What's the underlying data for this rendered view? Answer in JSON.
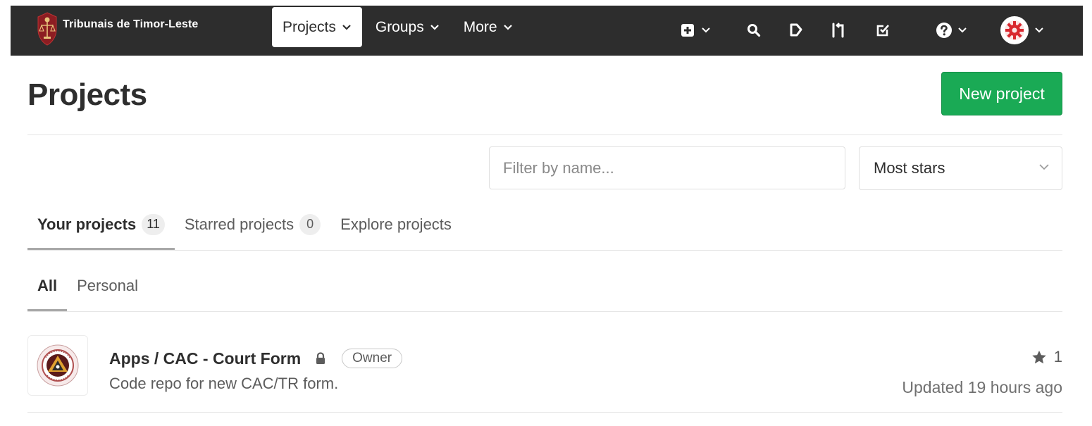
{
  "navbar": {
    "brand_name": "Tribunais de Timor-Leste",
    "menu": [
      {
        "label": "Projects",
        "active": true
      },
      {
        "label": "Groups",
        "active": false
      },
      {
        "label": "More",
        "active": false
      }
    ],
    "icons": [
      "plus-square-icon",
      "search-icon",
      "issues-icon",
      "merge-request-icon",
      "todo-icon",
      "help-icon",
      "user-avatar"
    ]
  },
  "header": {
    "title": "Projects",
    "new_project_label": "New project"
  },
  "filters": {
    "search_placeholder": "Filter by name...",
    "sort_selected": "Most stars"
  },
  "tabs": [
    {
      "label": "Your projects",
      "count": "11",
      "active": true
    },
    {
      "label": "Starred projects",
      "count": "0",
      "active": false
    },
    {
      "label": "Explore projects",
      "active": false
    }
  ],
  "subtabs": [
    {
      "label": "All",
      "active": true
    },
    {
      "label": "Personal",
      "active": false
    }
  ],
  "projects": [
    {
      "name": "Apps / CAC - Court Form",
      "visibility": "private",
      "role": "Owner",
      "description": "Code repo for new CAC/TR form.",
      "stars": "1",
      "updated": "Updated 19 hours ago"
    }
  ],
  "colors": {
    "navbar_bg": "#2d2d2d",
    "primary_green": "#1aaa55",
    "avatar_red": "#d9282f"
  }
}
